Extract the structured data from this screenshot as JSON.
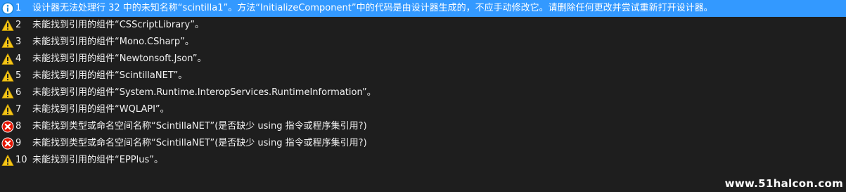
{
  "rows": [
    {
      "severity": "info",
      "icon": "info-icon",
      "num": "1",
      "desc": "设计器无法处理行 32 中的未知名称“scintilla1”。方法“InitializeComponent”中的代码是由设计器生成的，不应手动修改它。请删除任何更改并尝试重新打开设计器。",
      "selected": true
    },
    {
      "severity": "warning",
      "icon": "warning-icon",
      "num": "2",
      "desc": "未能找到引用的组件“CSScriptLibrary”。",
      "selected": false
    },
    {
      "severity": "warning",
      "icon": "warning-icon",
      "num": "3",
      "desc": "未能找到引用的组件“Mono.CSharp”。",
      "selected": false
    },
    {
      "severity": "warning",
      "icon": "warning-icon",
      "num": "4",
      "desc": "未能找到引用的组件“Newtonsoft.Json”。",
      "selected": false
    },
    {
      "severity": "warning",
      "icon": "warning-icon",
      "num": "5",
      "desc": "未能找到引用的组件“ScintillaNET”。",
      "selected": false
    },
    {
      "severity": "warning",
      "icon": "warning-icon",
      "num": "6",
      "desc": "未能找到引用的组件“System.Runtime.InteropServices.RuntimeInformation”。",
      "selected": false
    },
    {
      "severity": "warning",
      "icon": "warning-icon",
      "num": "7",
      "desc": "未能找到引用的组件“WQLAPI”。",
      "selected": false
    },
    {
      "severity": "error",
      "icon": "error-icon",
      "num": "8",
      "desc": "未能找到类型或命名空间名称“ScintillaNET”(是否缺少 using 指令或程序集引用?)",
      "selected": false
    },
    {
      "severity": "error",
      "icon": "error-icon",
      "num": "9",
      "desc": "未能找到类型或命名空间名称“ScintillaNET”(是否缺少 using 指令或程序集引用?)",
      "selected": false
    },
    {
      "severity": "warning",
      "icon": "warning-icon",
      "num": "10",
      "desc": "未能找到引用的组件“EPPlus”。",
      "selected": false
    }
  ],
  "watermark": "www.51halcon.com",
  "colors": {
    "background": "#1e1e1e",
    "selection": "#3399ff",
    "warning": "#f5c518",
    "error": "#e51400",
    "info": "#1a85d8"
  }
}
